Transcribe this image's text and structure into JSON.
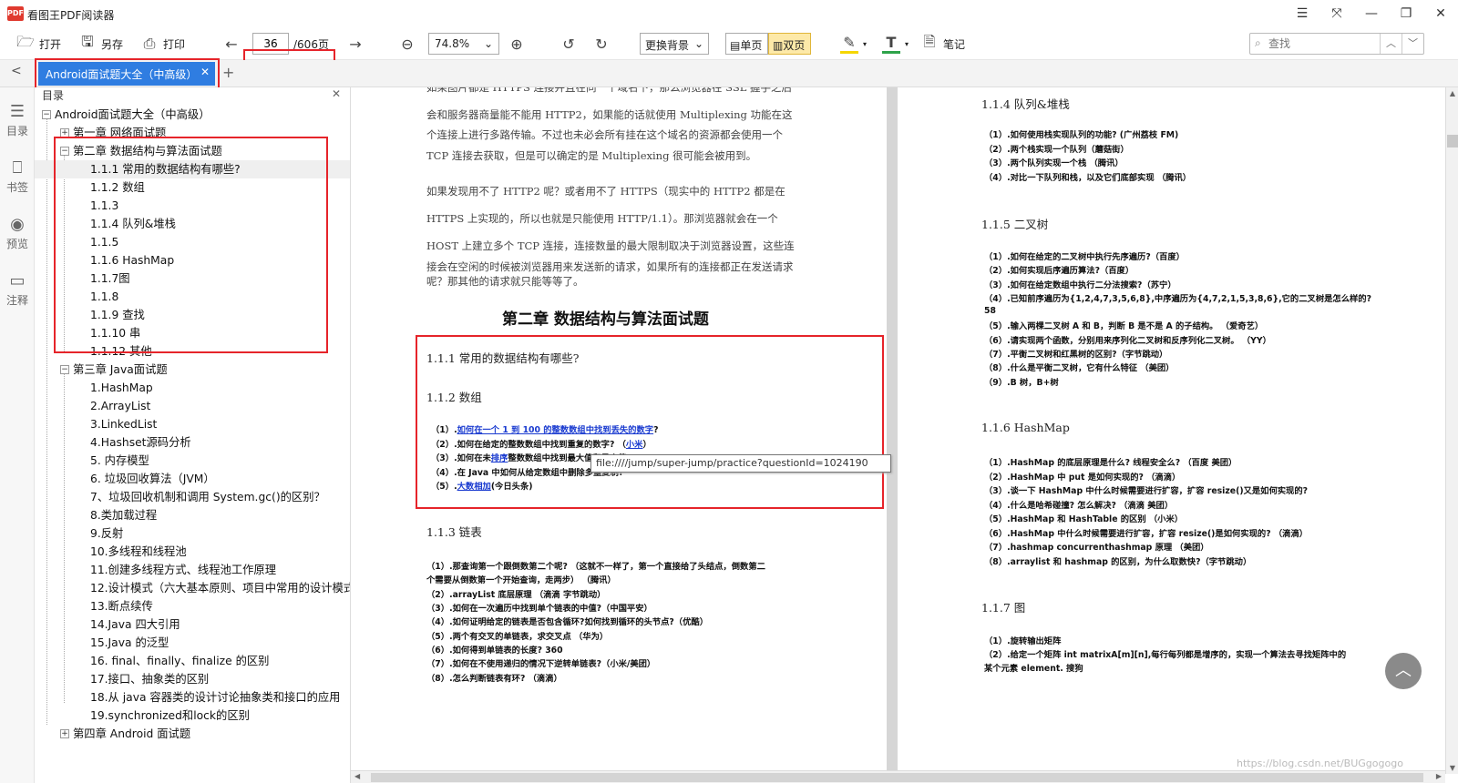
{
  "app": {
    "title": "看图王PDF阅读器",
    "logo": "PDF"
  },
  "toolbar": {
    "open": "打开",
    "save_as": "另存",
    "print": "打印",
    "page_current": "36",
    "page_total": "/606页",
    "zoom": "74.8%",
    "background": "更换背景",
    "single_page": "单页",
    "double_page": "双页",
    "note": "笔记",
    "search_placeholder": "查找"
  },
  "tabs": [
    {
      "label": "Android面试题大全（中高级）"
    }
  ],
  "leftbar": {
    "items": [
      {
        "label": "目录",
        "icon": "outline-icon"
      },
      {
        "label": "书签",
        "icon": "bookmark-icon"
      },
      {
        "label": "预览",
        "icon": "eye-icon"
      },
      {
        "label": "注释",
        "icon": "comment-icon"
      }
    ]
  },
  "outline": {
    "title": "目录",
    "items": [
      {
        "label": "Android面试题大全（中高级）"
      },
      {
        "label": "第一章 网络面试题"
      },
      {
        "label": "第二章 数据结构与算法面试题"
      },
      {
        "label": "1.1.1 常用的数据结构有哪些?"
      },
      {
        "label": "1.1.2 数组"
      },
      {
        "label": "1.1.3"
      },
      {
        "label": "1.1.4 队列&堆栈"
      },
      {
        "label": "1.1.5"
      },
      {
        "label": "1.1.6 HashMap"
      },
      {
        "label": "1.1.7图"
      },
      {
        "label": "1.1.8"
      },
      {
        "label": "1.1.9 查找"
      },
      {
        "label": "1.1.10 串"
      },
      {
        "label": "1.1.12 其他"
      },
      {
        "label": "第三章 Java面试题"
      },
      {
        "label": "1.HashMap"
      },
      {
        "label": "2.ArrayList"
      },
      {
        "label": "3.LinkedList"
      },
      {
        "label": "4.Hashset源码分析"
      },
      {
        "label": "5. 内存模型"
      },
      {
        "label": "6. 垃圾回收算法（JVM）"
      },
      {
        "label": "7、垃圾回收机制和调用 System.gc()的区别？"
      },
      {
        "label": "8.类加载过程"
      },
      {
        "label": "9.反射"
      },
      {
        "label": "10.多线程和线程池"
      },
      {
        "label": "11.创建多线程方式、线程池工作原理"
      },
      {
        "label": "12.设计模式（六大基本原则、项目中常用的设计模式"
      },
      {
        "label": "13.断点续传"
      },
      {
        "label": "14.Java 四大引用"
      },
      {
        "label": "15.Java 的泛型"
      },
      {
        "label": "16. final、finally、finalize 的区别"
      },
      {
        "label": "17.接口、抽象类的区别"
      },
      {
        "label": "18.从 java 容器类的设计讨论抽象类和接口的应用"
      },
      {
        "label": "19.synchronized和lock的区别"
      },
      {
        "label": "第四章 Android 面试题"
      }
    ]
  },
  "page_left": {
    "para1": [
      "如果图片都是 HTTPS 连接并且在同一个域名下，那么浏览器在 SSL 握手之后",
      "会和服务器商量能不能用 HTTP2，如果能的话就使用 Multiplexing 功能在这",
      "个连接上进行多路传输。不过也未必会所有挂在这个域名的资源都会使用一个",
      "TCP 连接去获取，但是可以确定的是 Multiplexing 很可能会被用到。"
    ],
    "para2": [
      "如果发现用不了 HTTP2 呢？或者用不了 HTTPS（现实中的 HTTP2 都是在",
      "HTTPS 上实现的，所以也就是只能使用 HTTP/1.1）。那浏览器就会在一个",
      "HOST 上建立多个 TCP 连接，连接数量的最大限制取决于浏览器设置，这些连",
      "接会在空闲的时候被浏览器用来发送新的请求，如果所有的连接都正在发送请求",
      "呢？那其他的请求就只能等等了。"
    ],
    "chapter": "第二章  数据结构与算法面试题",
    "h111": "1.1.1 常用的数据结构有哪些?",
    "h112": "1.1.2 数组",
    "arr": [
      {
        "pre": "（1）.",
        "link": "如何在一个 1 到 100 的整数数组中找到丢失的数字",
        "post": "?"
      },
      {
        "pre": "（2）.如何在给定的整数数组中找到重复的数字?  （",
        "link": "小米",
        "post": "）"
      },
      {
        "pre": "（3）.如何在未",
        "link": "排序",
        "post": "整数数组中找到最大值和最小值?"
      },
      {
        "pre": "（4）.在 Java 中如何从给定数组中删除多重复制?",
        "link": "",
        "post": ""
      },
      {
        "pre": "（5）.",
        "link": "大数相加",
        "post": "(今日头条)"
      }
    ],
    "tooltip": "file:////jump/super-jump/practice?questionId=1024190",
    "h113": "1.1.3 链表",
    "ll": [
      "（1）.那查询第一个跟倒数第二个呢? （这就不一样了，第一个直接给了头结点，倒数第二",
      "个需要从倒数第一个开始查询，走两步）  （腾讯）",
      "（2）.arrayList 底层原理  （滴滴 字节跳动）",
      "（3）.如何在一次遍历中找到单个链表的中值?（中国平安）",
      "（4）.如何证明给定的链表是否包含循环?如何找到循环的头节点?（优酷）",
      "（5）.两个有交叉的单链表，求交叉点  （华为）",
      "（6）.如何得到单链表的长度? 360",
      "（7）.如何在不使用递归的情况下逆转单链表?（小米/美团）",
      "（8）.怎么判断链表有环?  （滴滴）"
    ]
  },
  "page_right": {
    "h114": "1.1.4 队列&堆栈",
    "q114": [
      "（1）.如何使用栈实现队列的功能? (广州荔枝 FM)",
      "（2）.两个栈实现一个队列（蘑菇街）",
      "（3）.两个队列实现一个栈  （腾讯）",
      "（4）.对比一下队列和栈，以及它们底部实现  （腾讯）"
    ],
    "h115": "1.1.5 二叉树",
    "q115": [
      "（1）.如何在给定的二叉树中执行先序遍历?（百度）",
      "（2）.如何实现后序遍历算法?（百度）",
      "（3）.如何在给定数组中执行二分法搜索?（苏宁）",
      "（4）.已知前序遍历为{1,2,4,7,3,5,6,8},中序遍历为{4,7,2,1,5,3,8,6},它的二叉树是怎么样的?",
      "58",
      "（5）.输入两棵二叉树 A 和 B，判断 B 是不是 A 的子结构。  （爱奇艺）",
      "（6）.请实现两个函数，分别用来序列化二叉树和反序列化二叉树。  （YY）",
      "（7）.平衡二叉树和红黑树的区别?（字节跳动）",
      "（8）.什么是平衡二叉树，它有什么特征  （美团）",
      "（9）.B 树，B+树"
    ],
    "h116": "1.1.6 HashMap",
    "q116": [
      "（1）.HashMap 的底层原理是什么? 线程安全么?  （百度 美团）",
      "（2）.HashMap 中 put 是如何实现的?  （滴滴）",
      "（3）.谈一下 HashMap 中什么时候需要进行扩容，扩容 resize()又是如何实现的?",
      "（4）.什么是哈希碰撞? 怎么解决?  （滴滴 美团）",
      "（5）.HashMap 和 HashTable 的区别  （小米）",
      "（6）.HashMap 中什么时候需要进行扩容，扩容 resize()是如何实现的?  （滴滴）",
      "（7）.hashmap concurrenthashmap 原理  （美团）",
      "（8）.arraylist 和 hashmap 的区别，为什么取数快?（字节跳动）"
    ],
    "h117": "1.1.7 图",
    "q117": [
      "（1）.旋转输出矩阵",
      "（2）.给定一个矩阵 int matrixA[m][n],每行每列都是增序的，实现一个算法去寻找矩阵中的",
      "某个元素 element. 搜狗"
    ]
  },
  "watermark": "https://blog.csdn.net/BUGgogogo",
  "colors": {
    "accent": "#2f7de1",
    "highlight_border": "#e6242a",
    "link": "#1a3bd0"
  }
}
